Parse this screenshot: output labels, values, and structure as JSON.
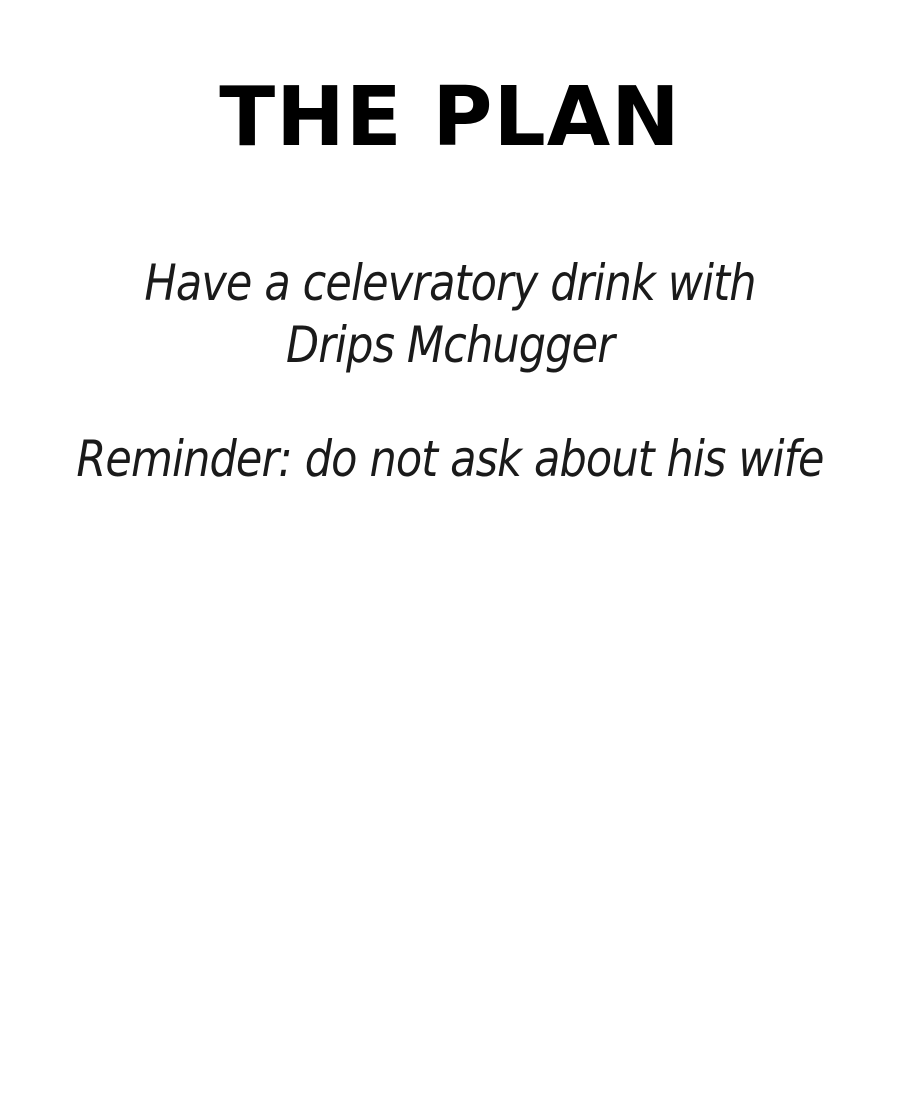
{
  "title": "THE PLAN",
  "notes": [
    {
      "lines": [
        "Have a celevratory drink with",
        "Drips Mchugger"
      ]
    },
    {
      "lines": [
        "Reminder: do not ask about his wife"
      ]
    }
  ],
  "colors": {
    "background": "#ffffff",
    "text": "#000000"
  }
}
